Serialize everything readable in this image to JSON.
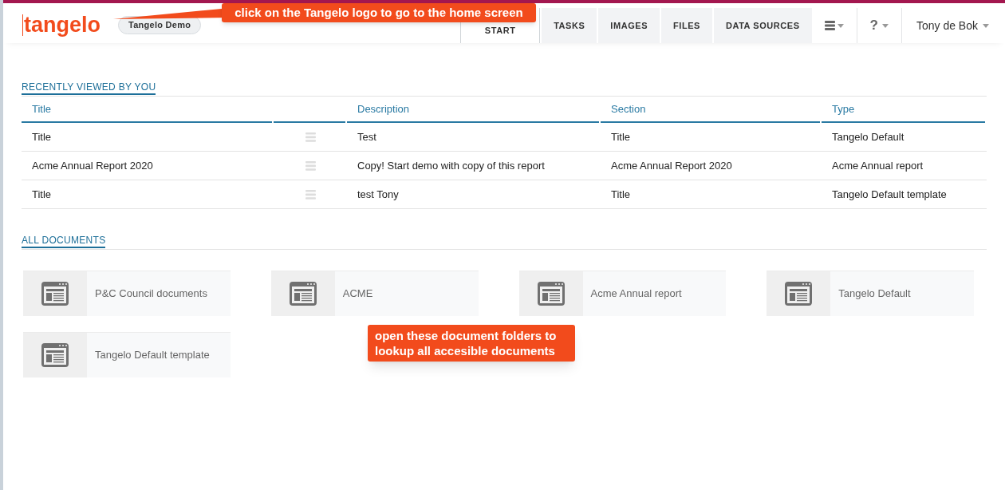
{
  "header": {
    "logo": "tangelo",
    "workspace": "Tangelo Demo",
    "tabs": [
      {
        "label": "START",
        "selected": true
      },
      {
        "label": "TASKS",
        "selected": false
      },
      {
        "label": "IMAGES",
        "selected": false
      },
      {
        "label": "FILES",
        "selected": false
      },
      {
        "label": "DATA SOURCES",
        "selected": false
      }
    ],
    "help": "?",
    "user": "Tony de Bok"
  },
  "recent": {
    "title": "RECENTLY VIEWED BY YOU",
    "columns": [
      "Title",
      "Description",
      "Section",
      "Type"
    ],
    "rows": [
      {
        "title": "Title",
        "description": "Test",
        "section": "Title",
        "type": "Tangelo Default"
      },
      {
        "title": "Acme Annual Report 2020",
        "description": "Copy! Start demo with copy of this report",
        "section": "Acme Annual Report 2020",
        "type": "Acme Annual report"
      },
      {
        "title": "Title",
        "description": "test Tony",
        "section": "Title",
        "type": "Tangelo Default template"
      }
    ]
  },
  "documents": {
    "title": "ALL DOCUMENTS",
    "folders": [
      "P&C Council documents",
      "ACME",
      "Acme Annual report",
      "Tangelo Default",
      "Tangelo Default template"
    ]
  },
  "callouts": [
    "click on the Tangelo logo to go to the home screen",
    "open these document folders to lookup all accesible documents"
  ]
}
